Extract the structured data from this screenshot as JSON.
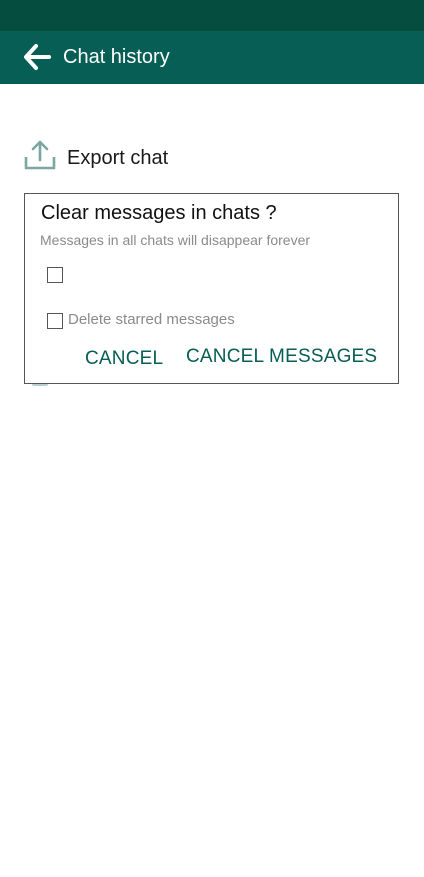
{
  "header": {
    "title": "Chat history"
  },
  "options": {
    "export_label": "Export chat"
  },
  "dialog": {
    "title": "Clear messages in chats ?",
    "subtitle": "Messages in all chats will disappear forever",
    "checkbox_1_label": "",
    "checkbox_2_label": "Delete starred messages",
    "cancel_label": "CANCEL",
    "confirm_label": "CANCEL MESSAGES"
  },
  "colors": {
    "status_bar": "#054d3e",
    "app_bar": "#075e54",
    "accent": "#075e54"
  },
  "icons": {
    "back": "arrow-left-icon",
    "export": "upload-icon"
  }
}
